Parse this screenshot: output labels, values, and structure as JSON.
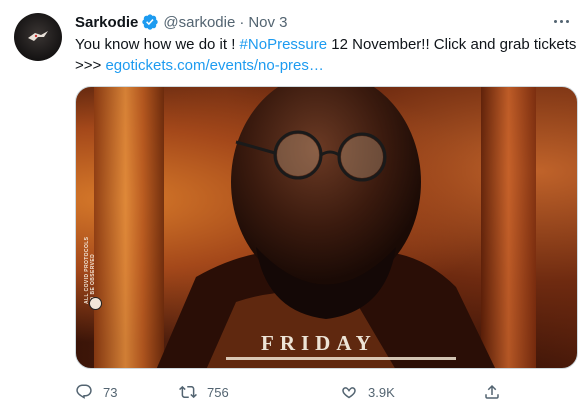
{
  "tweet": {
    "author": {
      "name": "Sarkodie",
      "handle": "@sarkodie",
      "separator": "·",
      "date": "Nov 3",
      "verified": true
    },
    "text": {
      "part1": "You know how we do it ! ",
      "hashtag": "#NoPressure",
      "part2": " 12 November!! Click and grab tickets >>> ",
      "link": "egotickets.com/events/no-pres…"
    },
    "media": {
      "heading": "FRIDAY",
      "side_notice": "ALL COVID PROTOCOLS TO BE OBSERVED"
    },
    "actions": {
      "replies": "73",
      "retweets": "756",
      "likes": "3.9K"
    },
    "icons": [
      "verified-badge-icon",
      "more-options-icon",
      "reply-icon",
      "retweet-icon",
      "like-icon",
      "share-icon"
    ],
    "colors": {
      "link": "#1d9bf0",
      "text": "#0f1419",
      "muted": "#536471",
      "verified": "#1d9bf0"
    }
  }
}
